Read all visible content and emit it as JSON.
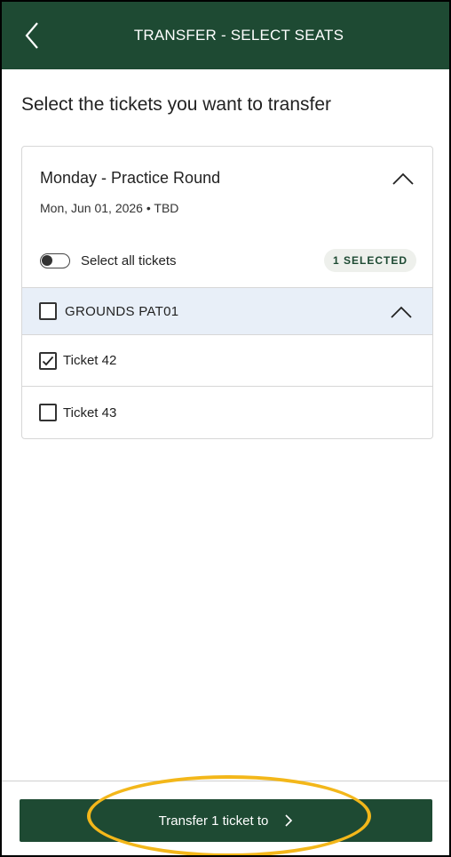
{
  "header": {
    "title": "TRANSFER - SELECT SEATS",
    "back_icon": "chevron-left-icon"
  },
  "heading": "Select the tickets you want to transfer",
  "event": {
    "title": "Monday - Practice Round",
    "date": "Mon, Jun 01, 2026 • TBD",
    "expanded": true
  },
  "select_all": {
    "label": "Select all tickets",
    "enabled": false,
    "selected_badge": "1 SELECTED"
  },
  "group": {
    "label": "GROUNDS PAT01",
    "checked": false,
    "expanded": true
  },
  "tickets": [
    {
      "label": "Ticket 42",
      "checked": true
    },
    {
      "label": "Ticket 43",
      "checked": false
    }
  ],
  "footer": {
    "transfer_label": "Transfer 1 ticket to"
  },
  "colors": {
    "brand_green": "#1e4a33",
    "group_row_bg": "#e8eff8",
    "highlight": "#f3b71a"
  }
}
